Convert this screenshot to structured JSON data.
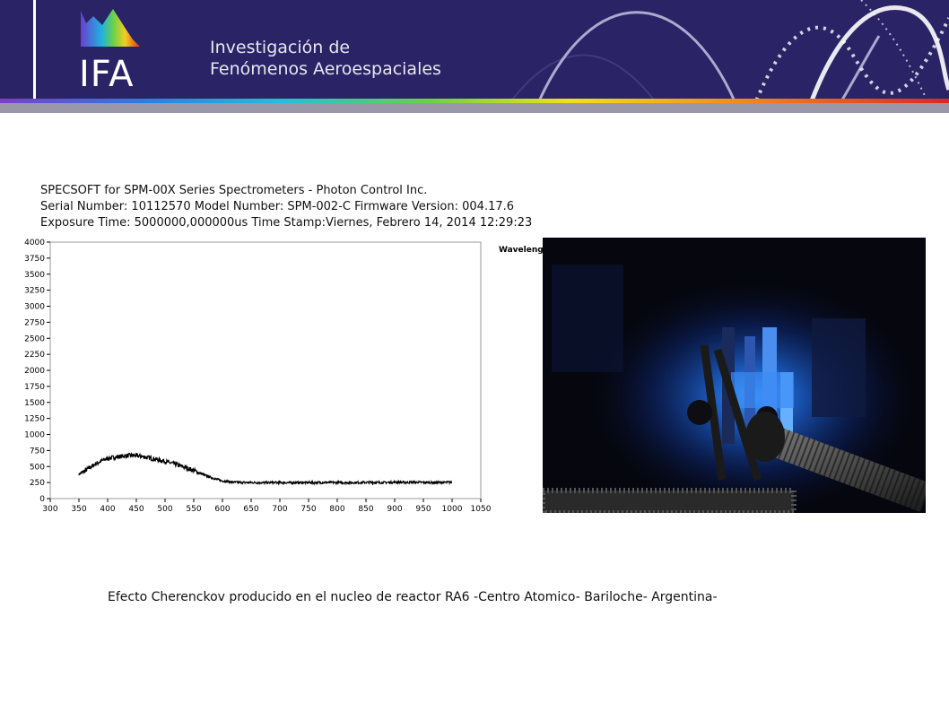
{
  "header": {
    "logo_text": "IFA",
    "title_line1": "Investigación de",
    "title_line2": "Fenómenos Aeroespaciales"
  },
  "spectrometer": {
    "line1": "SPECSOFT for SPM-00X Series Spectrometers - Photon Control Inc.",
    "line2": "Serial Number: 10112570    Model Number: SPM-002-C   Firmware Version: 004.17.6",
    "line3": "Exposure Time: 5000000,000000us  Time Stamp:Viernes, Febrero 14, 2014 12:29:23",
    "side_label": "Waveleng"
  },
  "chart_data": {
    "type": "line",
    "xlim": [
      300,
      1050
    ],
    "ylim": [
      0,
      4000
    ],
    "xticks": [
      300,
      350,
      400,
      450,
      500,
      550,
      600,
      650,
      700,
      750,
      800,
      850,
      900,
      950,
      1000,
      1050
    ],
    "yticks": [
      0,
      250,
      500,
      750,
      1000,
      1250,
      1500,
      1750,
      2000,
      2250,
      2500,
      2750,
      3000,
      3250,
      3500,
      3750,
      4000
    ],
    "grid": false,
    "series": [
      {
        "x": [
          350,
          360,
          370,
          380,
          390,
          400,
          410,
          420,
          430,
          440,
          450,
          460,
          470,
          480,
          490,
          500,
          510,
          520,
          530,
          540,
          550,
          560,
          570,
          580,
          590,
          600,
          620,
          640,
          660,
          680,
          700,
          720,
          740,
          760,
          780,
          800,
          820,
          840,
          860,
          880,
          900,
          920,
          940,
          960,
          980,
          1000
        ],
        "y": [
          380,
          430,
          490,
          545,
          590,
          625,
          640,
          655,
          665,
          675,
          670,
          655,
          640,
          620,
          600,
          580,
          555,
          530,
          500,
          470,
          440,
          400,
          360,
          330,
          300,
          275,
          255,
          250,
          250,
          248,
          250,
          248,
          250,
          248,
          250,
          250,
          248,
          250,
          252,
          250,
          255,
          252,
          255,
          250,
          250,
          255
        ],
        "color": "#000000"
      }
    ]
  },
  "caption": "Efecto  Cherenckov producido en el nucleo de reactor  RA6 -Centro Atomico- Bariloche- Argentina-"
}
